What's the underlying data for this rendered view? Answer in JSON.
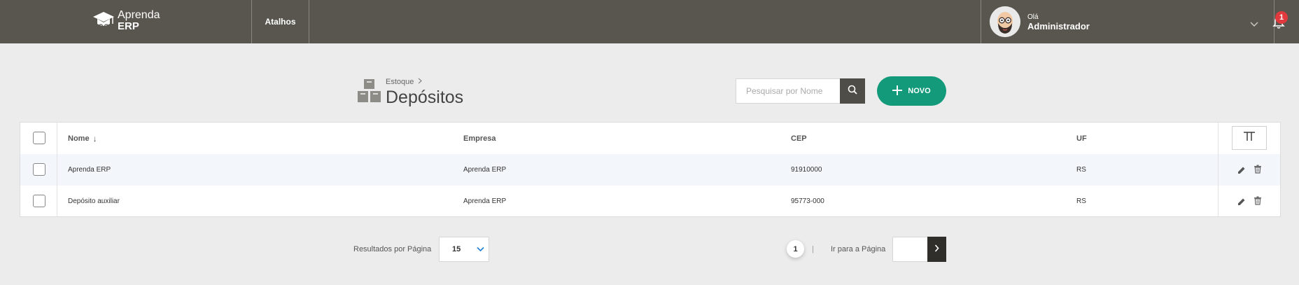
{
  "header": {
    "logo_line1": "Aprenda",
    "logo_line2": "ERP",
    "shortcuts_label": "Atalhos",
    "user_greeting": "Olá",
    "user_name": "Administrador",
    "notification_count": "1"
  },
  "page": {
    "breadcrumb_parent": "Estoque",
    "title": "Depósitos",
    "search_placeholder": "Pesquisar por Nome",
    "new_button_label": "NOVO"
  },
  "table": {
    "columns": {
      "name": "Nome",
      "sort_indicator": "↓",
      "company": "Empresa",
      "cep": "CEP",
      "uf": "UF"
    },
    "rows": [
      {
        "name": "Aprenda ERP",
        "company": "Aprenda ERP",
        "cep": "91910000",
        "uf": "RS"
      },
      {
        "name": "Depósito auxiliar",
        "company": "Aprenda ERP",
        "cep": "95773-000",
        "uf": "RS"
      }
    ]
  },
  "pagination": {
    "results_per_page_label": "Resultados por Página",
    "results_per_page_value": "15",
    "current_page": "1",
    "separator": "|",
    "go_to_page_label": "Ir para a Página"
  },
  "colors": {
    "topbar": "#58564e",
    "accent_green": "#139a7a",
    "badge_red": "#e03a3e",
    "selected_row": "#f3f6fa"
  }
}
